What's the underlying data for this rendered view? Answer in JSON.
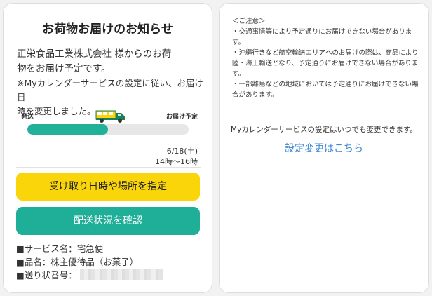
{
  "left_card": {
    "title": "お荷物お届けのお知らせ",
    "message_line1": "正栄食品工業株式会社 様からのお荷",
    "message_line2": "物をお届け予定です。",
    "note_line1": "※Myカレンダーサービスの設定に従い、お届け日",
    "note_line2": "時を変更しました。",
    "progress": {
      "start_label": "発送",
      "end_label": "お届け予定",
      "fraction": 0.5,
      "fill_color": "#21b098"
    },
    "date": "6/18(土)",
    "time": "14時～16時",
    "change_button": "受け取り日時や場所を指定",
    "status_button": "配送状況を確認",
    "service": "■サービス名：宅急便",
    "item": "■品名：株主優待品（お菓子）",
    "tracking_label": "■送り状番号："
  },
  "right_card": {
    "notice_header": "＜ご注意＞",
    "notice_item1": "・交通事情等により予定通りにお届けできない場合があります。",
    "notice_item2": "・沖縄行きなど航空輸送エリアへのお届けの際は、商品により陸・海上輸送となり、予定通りにお届けできない場合があります。",
    "notice_item3": "・一部離島などの地域においては予定通りにお届けできない場合があります。",
    "calendar_note": "Myカレンダーサービスの設定はいつでも変更できます。",
    "settings_link": "設定変更はこちら"
  },
  "colors": {
    "yellow_button": "#f9d50a",
    "teal_button": "#1fae97",
    "link": "#3d8ad1"
  },
  "icons": [
    "delivery-truck-icon"
  ]
}
